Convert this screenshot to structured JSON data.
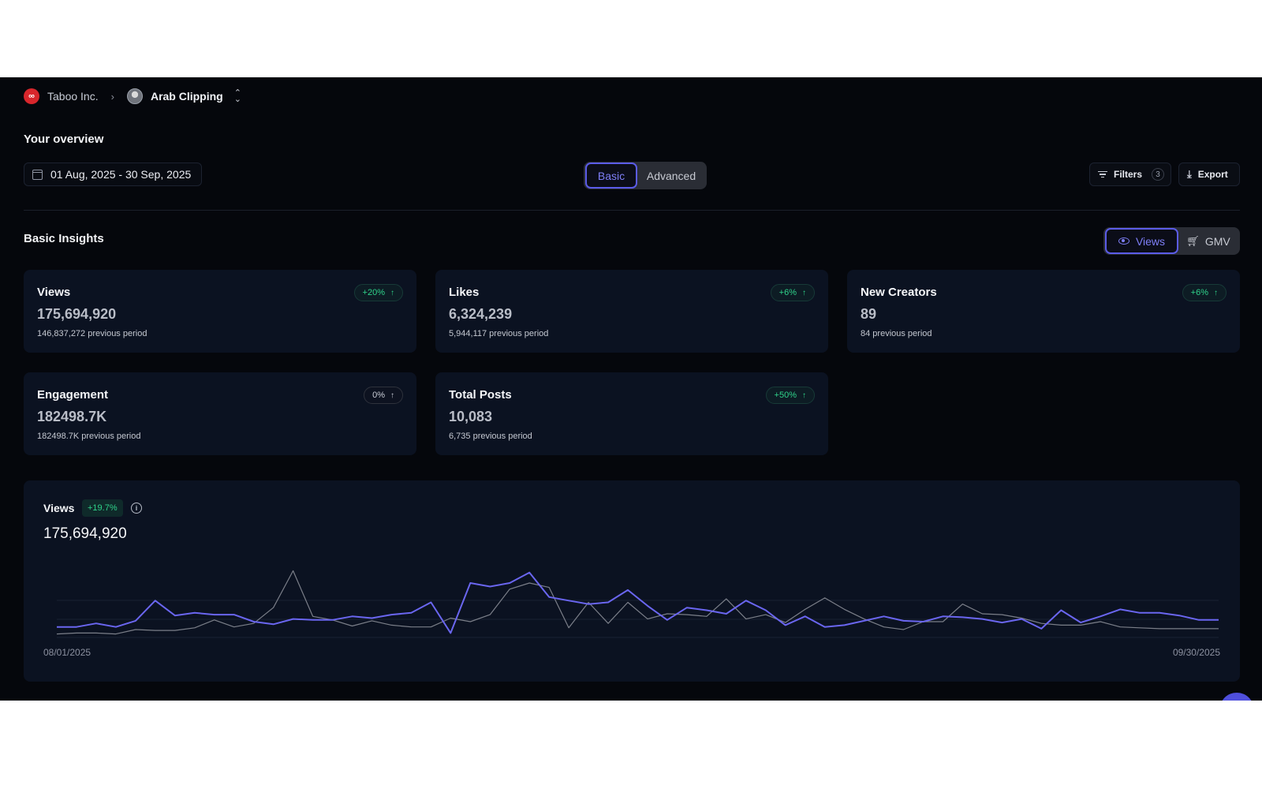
{
  "breadcrumb": {
    "org": "Taboo Inc.",
    "project": "Arab Clipping"
  },
  "overview": {
    "title": "Your overview",
    "date_range": "01 Aug, 2025 - 30 Sep, 2025",
    "modes": [
      "Basic",
      "Advanced"
    ],
    "active_mode": "Basic",
    "filters_label": "Filters",
    "filters_count": "3",
    "export_label": "Export"
  },
  "insights": {
    "title": "Basic Insights",
    "metric_options": [
      "Views",
      "GMV"
    ],
    "active_metric": "Views",
    "cards": [
      {
        "title": "Views",
        "value": "175,694,920",
        "previous": "146,837,272 previous period",
        "change": "+20%",
        "trend": "positive"
      },
      {
        "title": "Likes",
        "value": "6,324,239",
        "previous": "5,944,117 previous period",
        "change": "+6%",
        "trend": "positive"
      },
      {
        "title": "New Creators",
        "value": "89",
        "previous": "84 previous period",
        "change": "+6%",
        "trend": "positive"
      },
      {
        "title": "Engagement",
        "value": "182498.7K",
        "previous": "182498.7K previous period",
        "change": "0%",
        "trend": "neutral"
      },
      {
        "title": "Total Posts",
        "value": "10,083",
        "previous": "6,735 previous period",
        "change": "+50%",
        "trend": "positive"
      }
    ]
  },
  "chart": {
    "title": "Views",
    "change": "+19.7%",
    "total": "175,694,920",
    "x_start": "08/01/2025",
    "x_end": "09/30/2025"
  },
  "colors": {
    "accent": "#5b5ce8",
    "positive": "#2fd38a",
    "current_series": "#6a66f0",
    "previous_series": "#7b7f89"
  },
  "chart_data": {
    "type": "line",
    "x_range": [
      "08/01/2025",
      "09/30/2025"
    ],
    "grid": true,
    "series": [
      {
        "values": [
          12,
          12,
          16,
          12,
          19,
          42,
          25,
          28,
          26,
          26,
          18,
          15,
          21,
          20,
          20,
          24,
          22,
          26,
          28,
          40,
          5,
          62,
          58,
          62,
          74,
          46,
          42,
          38,
          40,
          54,
          36,
          20,
          34,
          31,
          27,
          42,
          31,
          14,
          24,
          12,
          14,
          19,
          24,
          19,
          18,
          24,
          23,
          21,
          17,
          21,
          10,
          31,
          17,
          24,
          32,
          28,
          28,
          25,
          20,
          20
        ]
      },
      {
        "values": [
          4,
          5,
          5,
          4,
          9,
          8,
          8,
          11,
          20,
          12,
          16,
          34,
          76,
          24,
          20,
          13,
          19,
          14,
          12,
          12,
          22,
          18,
          26,
          55,
          62,
          57,
          11,
          40,
          16,
          40,
          21,
          27,
          26,
          24,
          44,
          21,
          26,
          17,
          32,
          45,
          32,
          21,
          12,
          9,
          18,
          18,
          38,
          27,
          26,
          22,
          16,
          14,
          14,
          18,
          12,
          11,
          10,
          10,
          10,
          10
        ]
      }
    ]
  }
}
